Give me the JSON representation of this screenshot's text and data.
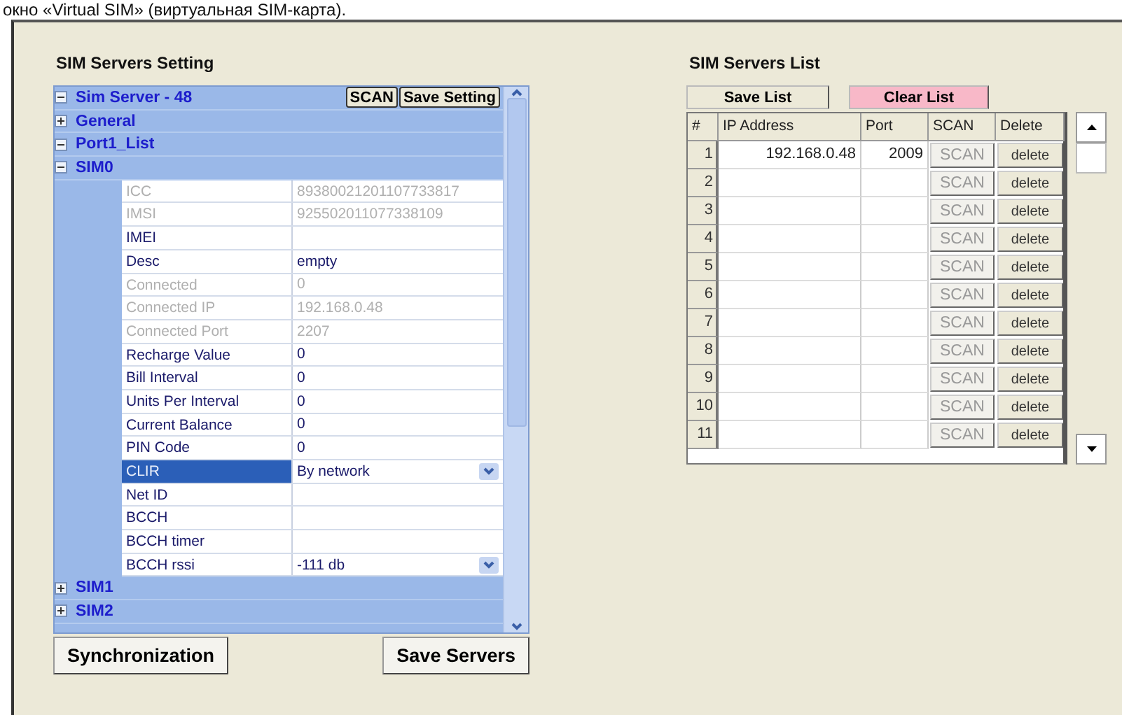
{
  "caption": "окно «Virtual SIM» (виртуальная SIM-карта).",
  "settings": {
    "title": "SIM Servers Setting",
    "tree": [
      {
        "label": "Sim Server - 48",
        "expanded": true,
        "buttons": [
          "SCAN",
          "Save Setting"
        ],
        "children": [
          {
            "label": "General",
            "expanded": false
          },
          {
            "label": "Port1_List",
            "expanded": true,
            "children": [
              {
                "label": "SIM0",
                "expanded": true,
                "properties": [
                  {
                    "name": "ICC",
                    "value": "89380021201107733817",
                    "disabled": true,
                    "selected": false
                  },
                  {
                    "name": "IMSI",
                    "value": "925502011077338109",
                    "disabled": true,
                    "selected": false
                  },
                  {
                    "name": "IMEI",
                    "disabled": false,
                    "selected": false
                  },
                  {
                    "name": "Desc",
                    "value": "empty",
                    "disabled": false,
                    "selected": false
                  },
                  {
                    "name": "Connected",
                    "value": "0",
                    "disabled": true,
                    "selected": false
                  },
                  {
                    "name": "Connected IP",
                    "value": "192.168.0.48",
                    "disabled": true,
                    "selected": false
                  },
                  {
                    "name": "Connected Port",
                    "value": "2207",
                    "disabled": true,
                    "selected": false
                  },
                  {
                    "name": "Recharge Value",
                    "value": "0",
                    "disabled": false,
                    "selected": false
                  },
                  {
                    "name": "Bill Interval",
                    "value": "0",
                    "disabled": false,
                    "selected": false
                  },
                  {
                    "name": "Units Per Interval",
                    "value": "0",
                    "disabled": false,
                    "selected": false
                  },
                  {
                    "name": "Current Balance",
                    "value": "0",
                    "disabled": false,
                    "selected": false
                  },
                  {
                    "name": "PIN Code",
                    "value": "0",
                    "disabled": false,
                    "selected": false
                  },
                  {
                    "name": "CLIR",
                    "value": "By network",
                    "disabled": false,
                    "selected": true,
                    "kind": "dropdown"
                  },
                  {
                    "name": "Net ID",
                    "disabled": false,
                    "selected": false
                  },
                  {
                    "name": "BCCH",
                    "disabled": false,
                    "selected": false
                  },
                  {
                    "name": "BCCH timer",
                    "disabled": false,
                    "selected": false
                  },
                  {
                    "name": "BCCH rssi",
                    "value": "-111 db",
                    "disabled": false,
                    "selected": false,
                    "kind": "dropdown"
                  }
                ]
              },
              {
                "label": "SIM1",
                "expanded": false
              },
              {
                "label": "SIM2",
                "expanded": false
              }
            ]
          }
        ]
      }
    ],
    "buttons": [
      "Synchronization",
      "Save Servers"
    ]
  },
  "list": {
    "title": "SIM Servers List",
    "save_button": "Save List",
    "clear_button": "Clear List",
    "columns": [
      "#",
      "IP Address",
      "Port",
      "SCAN",
      "Delete"
    ],
    "rows": [
      {
        "num": "1",
        "ip": "192.168.0.48",
        "port": "2009",
        "scan": "SCAN",
        "delete": "delete"
      },
      {
        "num": "2",
        "ip": "",
        "port": "",
        "scan": "SCAN",
        "delete": "delete"
      },
      {
        "num": "3",
        "ip": "",
        "port": "",
        "scan": "SCAN",
        "delete": "delete"
      },
      {
        "num": "4",
        "ip": "",
        "port": "",
        "scan": "SCAN",
        "delete": "delete"
      },
      {
        "num": "5",
        "ip": "",
        "port": "",
        "scan": "SCAN",
        "delete": "delete"
      },
      {
        "num": "6",
        "ip": "",
        "port": "",
        "scan": "SCAN",
        "delete": "delete"
      },
      {
        "num": "7",
        "ip": "",
        "port": "",
        "scan": "SCAN",
        "delete": "delete"
      },
      {
        "num": "8",
        "ip": "",
        "port": "",
        "scan": "SCAN",
        "delete": "delete"
      },
      {
        "num": "9",
        "ip": "",
        "port": "",
        "scan": "SCAN",
        "delete": "delete"
      },
      {
        "num": "10",
        "ip": "",
        "port": "",
        "scan": "SCAN",
        "delete": "delete"
      },
      {
        "num": "11",
        "ip": "",
        "port": "",
        "scan": "SCAN",
        "delete": "delete"
      }
    ]
  }
}
